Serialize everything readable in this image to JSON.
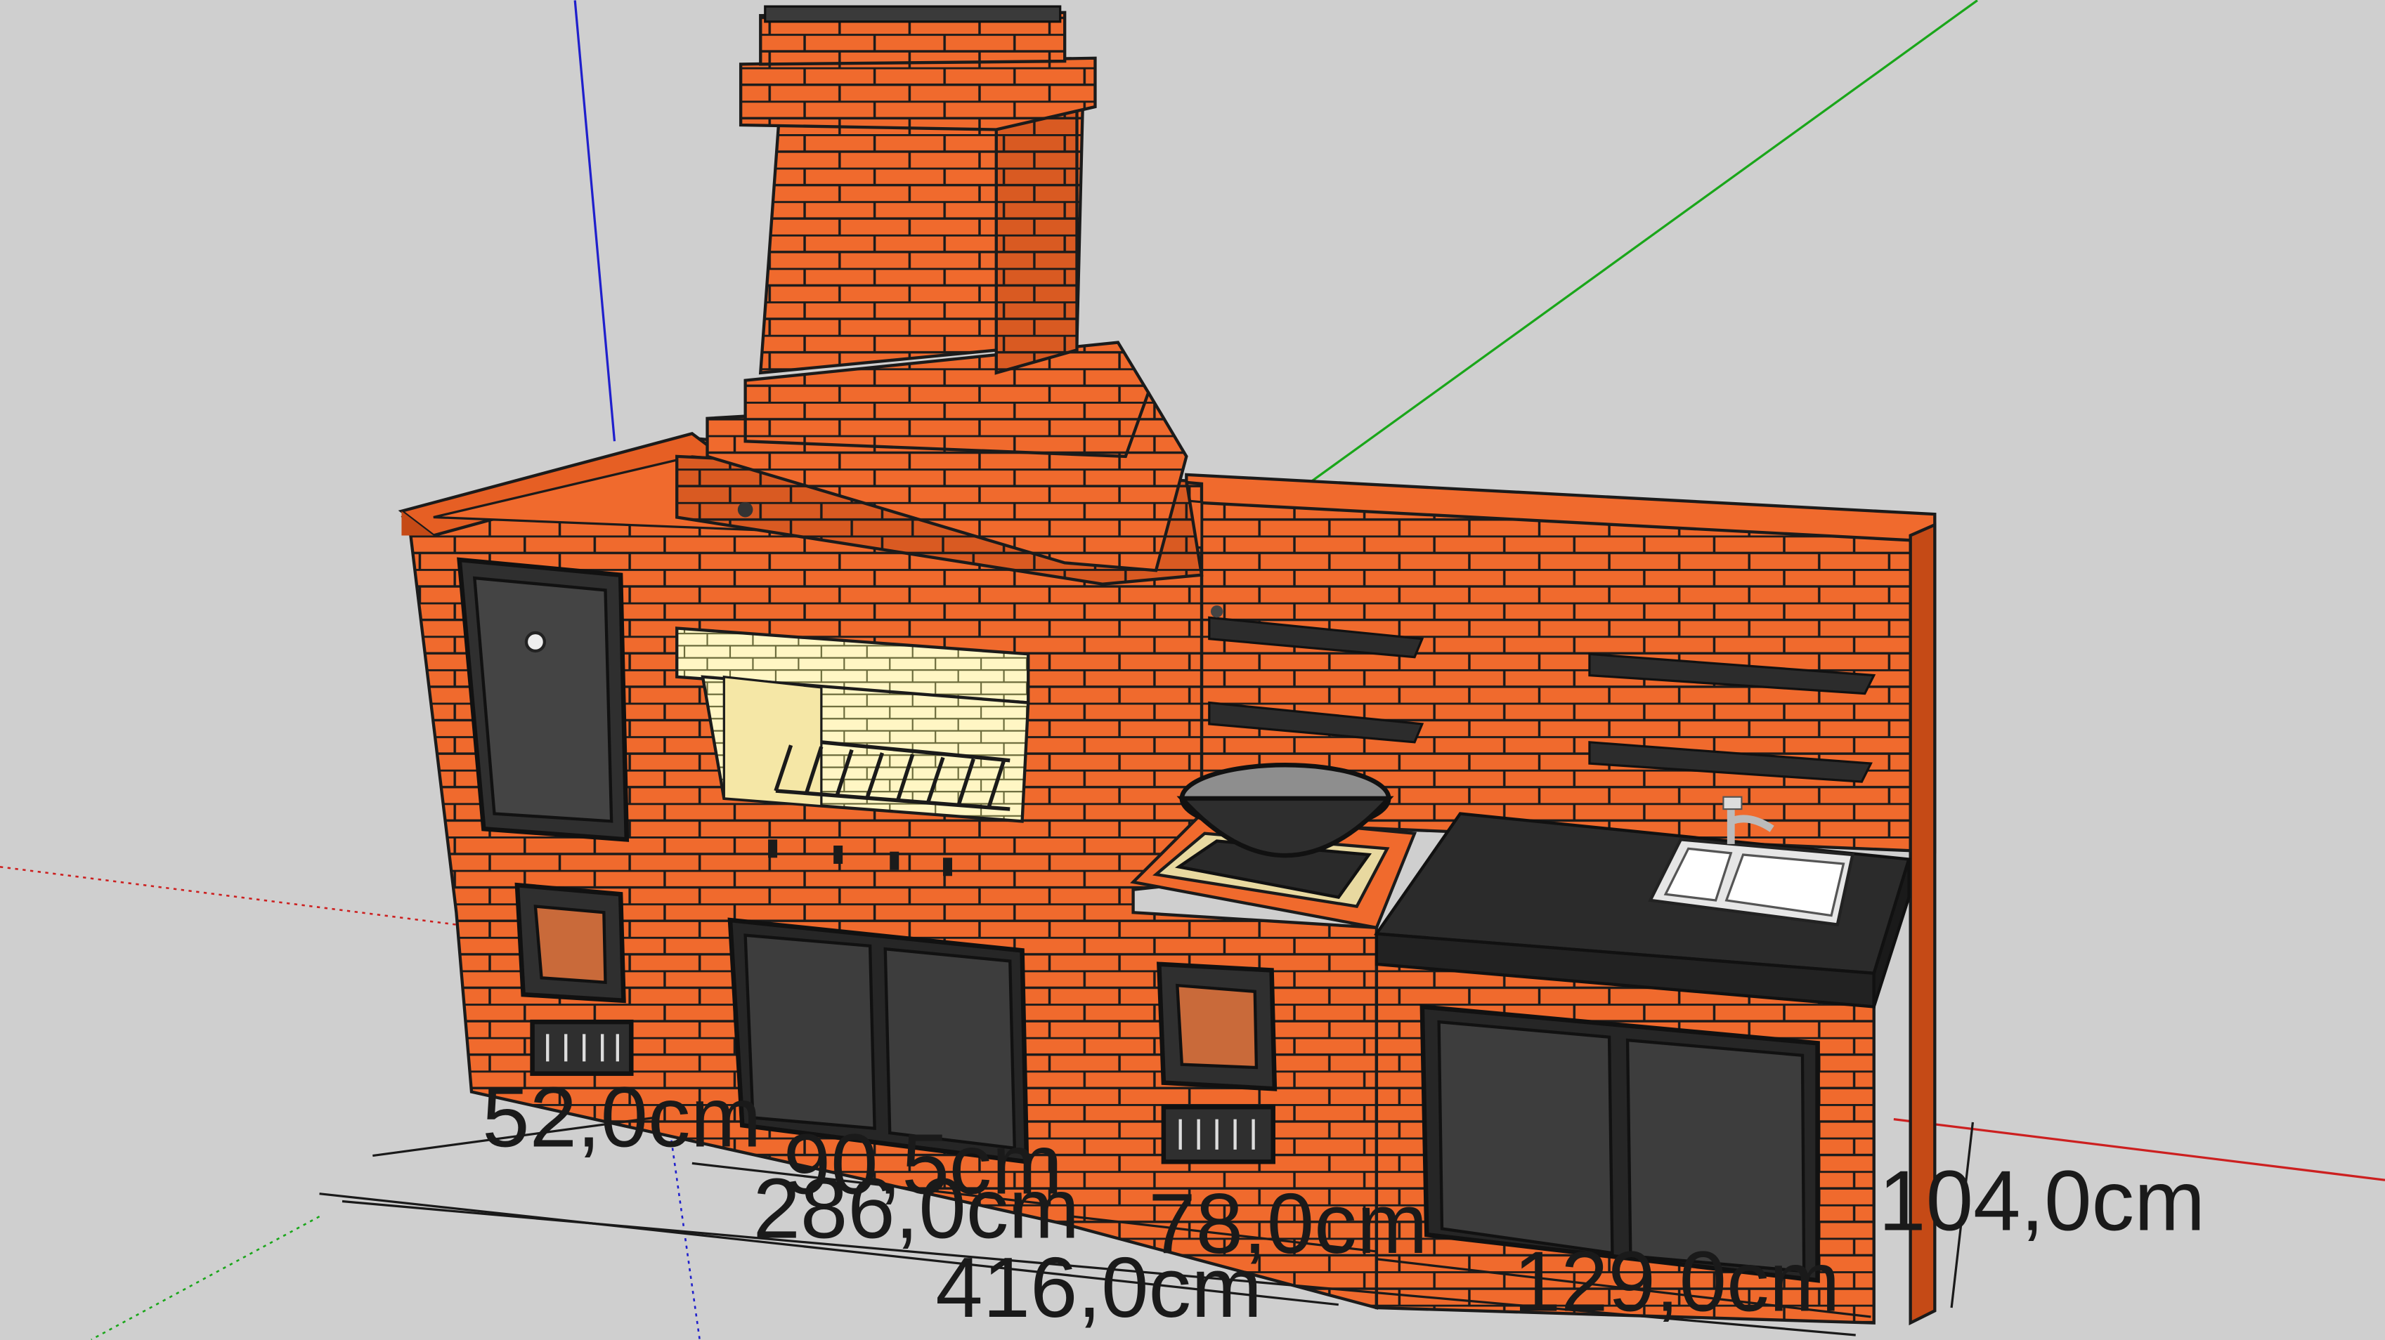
{
  "scene": {
    "background": "#cfcfcf",
    "colors": {
      "brick": "#f06a2d",
      "brick_dark": "#d9531c",
      "mortar": "#1b1b1b",
      "firebox_brick": "#fff6c4",
      "door": "#3a3a3a",
      "countertop": "#2b2b2b",
      "sink": "#f2f2f2",
      "axis_red": "#cc2020",
      "axis_green": "#1aa61a",
      "axis_blue": "#2020cc"
    },
    "objects": [
      "chimney",
      "grill-firebox",
      "smoker-door",
      "cauldron-wok",
      "countertop",
      "sink",
      "faucet",
      "shelves",
      "cabinet-doors",
      "oven-doors",
      "ash-vents"
    ]
  },
  "dimensions": {
    "d52": "52,0cm",
    "d90_5": "90,5cm",
    "d286": "286,0cm",
    "d78": "78,0cm",
    "d416": "416,0cm",
    "d129": "129,0cm",
    "d104": "104,0cm"
  }
}
